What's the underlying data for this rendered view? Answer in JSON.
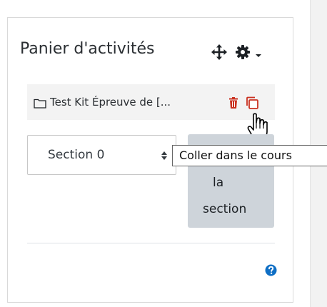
{
  "block": {
    "title": "Panier d'activités",
    "actions": {
      "move_icon": "move-arrows-icon",
      "settings_icon": "gear-icon",
      "menu_icon": "chevron-down-icon"
    },
    "item": {
      "icon": "folder-icon",
      "label": "Test Kit Épreuve de [...",
      "delete_icon": "trash-icon",
      "copy_icon": "copy-icon"
    },
    "section_select": {
      "value": "Section 0"
    },
    "paste_button": {
      "line1": "la",
      "line2": "section"
    },
    "tooltip": "Coller dans le cours",
    "help_icon": "question-circle-icon"
  },
  "colors": {
    "delete": "#ca3120",
    "help": "#0f6fc5",
    "button_bg": "#ced4da"
  }
}
